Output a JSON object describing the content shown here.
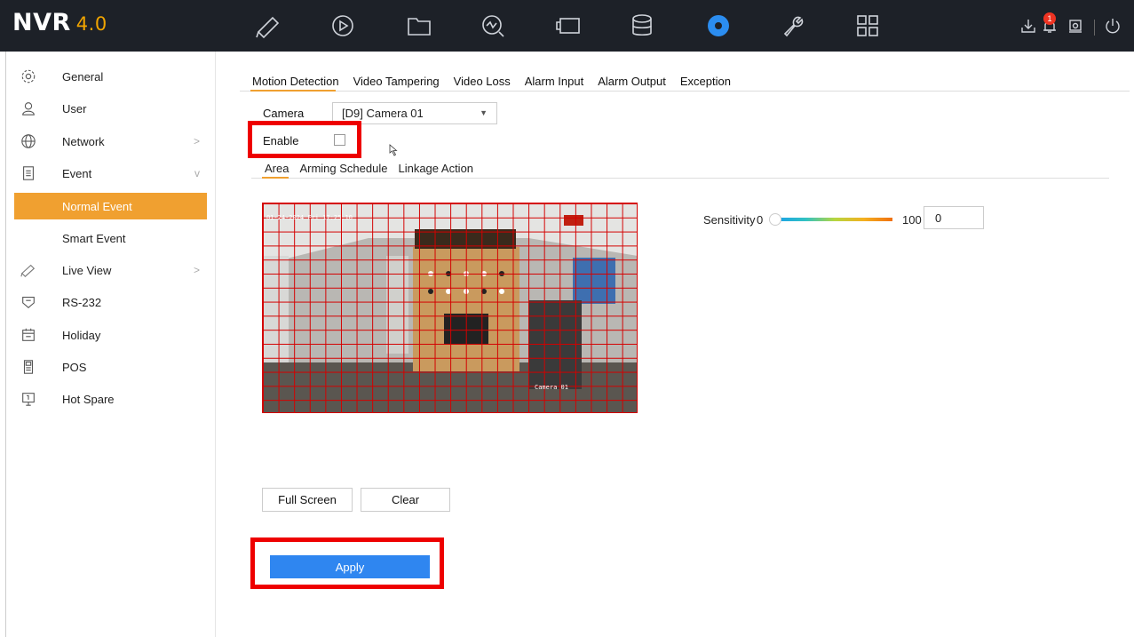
{
  "app": {
    "logo": "NVR",
    "version": "4.0",
    "notification_count": "1"
  },
  "topnav": [
    {
      "name": "live-view-icon"
    },
    {
      "name": "playback-icon"
    },
    {
      "name": "file-management-icon"
    },
    {
      "name": "smart-analysis-icon"
    },
    {
      "name": "camera-icon"
    },
    {
      "name": "storage-icon"
    },
    {
      "name": "configuration-icon",
      "active": true
    },
    {
      "name": "maintenance-icon"
    },
    {
      "name": "apps-grid-icon"
    }
  ],
  "sidebar": {
    "items": [
      {
        "label": "General",
        "icon": "gear-outline-icon"
      },
      {
        "label": "User",
        "icon": "user-icon"
      },
      {
        "label": "Network",
        "icon": "globe-icon",
        "chevron": ">"
      },
      {
        "label": "Event",
        "icon": "clipboard-icon",
        "chevron": "v"
      },
      {
        "label": "Normal Event",
        "active": true
      },
      {
        "label": "Smart Event"
      },
      {
        "label": "Live View",
        "icon": "camera-icon",
        "chevron": ">"
      },
      {
        "label": "RS-232",
        "icon": "serial-port-icon"
      },
      {
        "label": "Holiday",
        "icon": "calendar-icon"
      },
      {
        "label": "POS",
        "icon": "pos-icon"
      },
      {
        "label": "Hot Spare",
        "icon": "hot-spare-icon"
      }
    ]
  },
  "tabs": [
    "Motion Detection",
    "Video Tampering",
    "Video Loss",
    "Alarm Input",
    "Alarm Output",
    "Exception"
  ],
  "form": {
    "camera_label": "Camera",
    "camera_value": "[D9] Camera 01",
    "enable_label": "Enable",
    "enable_checked": false
  },
  "subtabs": [
    "Area",
    "Arming Schedule",
    "Linkage Action"
  ],
  "video": {
    "timestamp": "01-24-2024 Fri 17:25:10",
    "camera_name": "Camera 01"
  },
  "sensitivity": {
    "label": "Sensitivity",
    "min": "0",
    "max": "100",
    "value": "0"
  },
  "buttons": {
    "full_screen": "Full Screen",
    "clear": "Clear",
    "apply": "Apply"
  },
  "colors": {
    "accent": "#f0a030",
    "apply": "#2f86f0",
    "highlight": "#ee0000",
    "topbar": "#1d2128"
  }
}
